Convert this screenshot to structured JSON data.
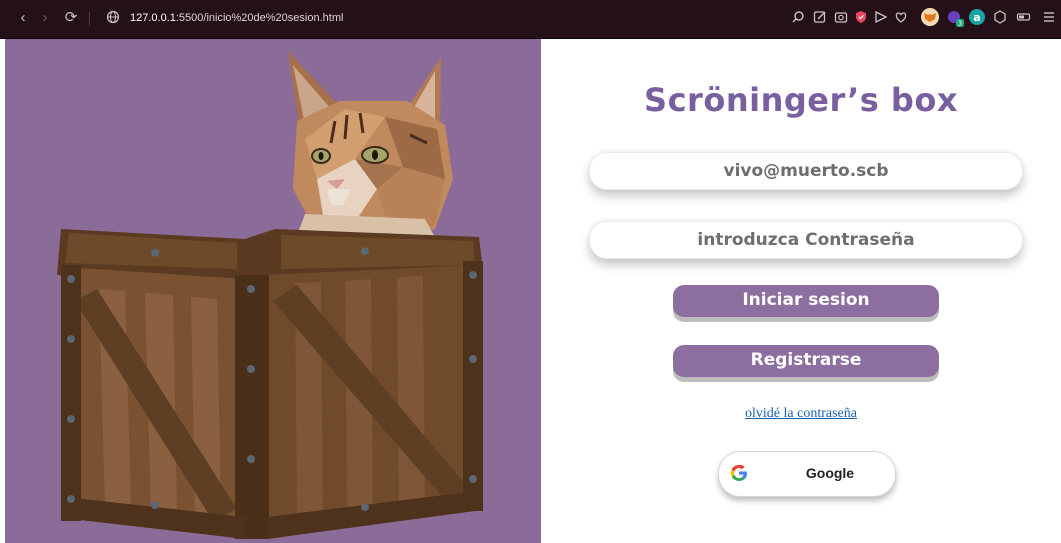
{
  "browser": {
    "url_host": "127.0.0.1",
    "url_rest": ":5500/inicio%20de%20sesion.html"
  },
  "hero": {
    "image": "cat-in-wooden-box",
    "background": "#8b6b98"
  },
  "login": {
    "title": "Scröninger’s box",
    "email_value": "vivo@muerto.scb",
    "password_placeholder": "introduzca Contraseña",
    "login_button": "Iniciar sesion",
    "register_button": "Registrarse",
    "forgot_link": "olvidé la contraseña",
    "google_button": "Google"
  },
  "colors": {
    "accent": "#7a5fa0",
    "button": "#8d6ea0",
    "link": "#1a5fb4"
  }
}
